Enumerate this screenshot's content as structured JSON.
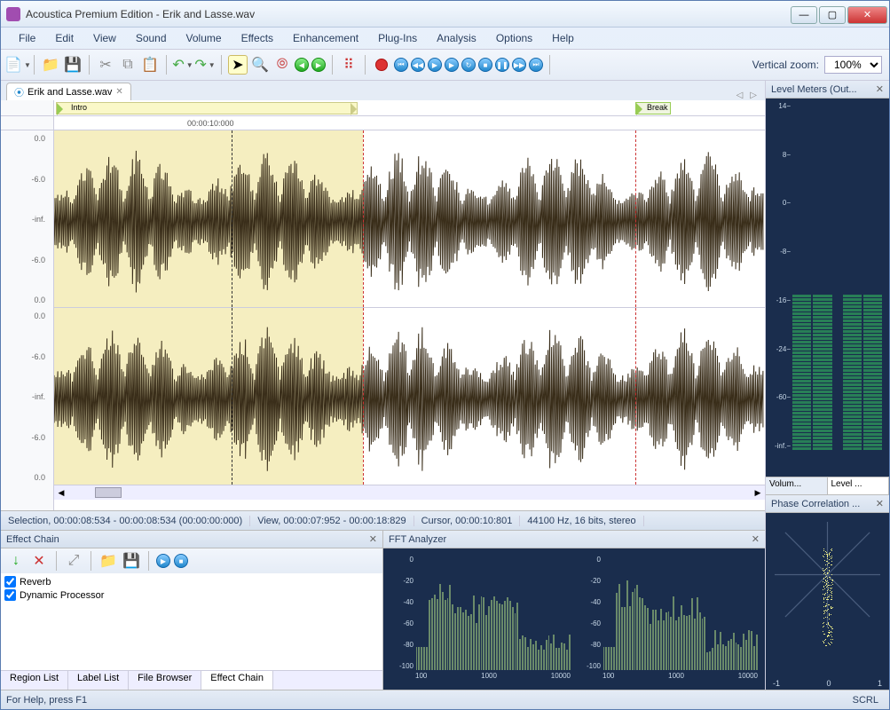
{
  "window": {
    "title": "Acoustica Premium Edition - Erik and Lasse.wav"
  },
  "menu": [
    "File",
    "Edit",
    "View",
    "Sound",
    "Volume",
    "Effects",
    "Enhancement",
    "Plug-Ins",
    "Analysis",
    "Options",
    "Help"
  ],
  "toolbar": {
    "vertical_zoom_label": "Vertical zoom:",
    "vertical_zoom_value": "100%"
  },
  "document": {
    "tab_label": "Erik and Lasse.wav",
    "timeline_cursor": "00:00:10:000",
    "markers": {
      "intro": "Intro",
      "break": "Break"
    },
    "db_scale": [
      "0.0",
      "-6.0",
      "-inf.",
      "-6.0",
      "0.0"
    ]
  },
  "status": {
    "selection": "Selection, 00:00:08:534 - 00:00:08:534 (00:00:00:000)",
    "view": "View, 00:00:07:952 - 00:00:18:829",
    "cursor": "Cursor, 00:00:10:801",
    "format": "44100 Hz, 16 bits, stereo"
  },
  "level_meters": {
    "title": "Level Meters (Out...",
    "scale": [
      "14−",
      "8−",
      "0−",
      "-8−",
      "-16−",
      "-24−",
      "-60−",
      "-inf.−"
    ],
    "tabs": [
      "Volum...",
      "Level ..."
    ]
  },
  "phase": {
    "title": "Phase Correlation ...",
    "labels": [
      "-1",
      "0",
      "1"
    ]
  },
  "effect_chain": {
    "title": "Effect Chain",
    "effects": [
      "Reverb",
      "Dynamic Processor"
    ],
    "tabs": [
      "Region List",
      "Label List",
      "File Browser",
      "Effect Chain"
    ]
  },
  "fft": {
    "title": "FFT Analyzer",
    "y_scale": [
      "0",
      "-20",
      "-40",
      "-60",
      "-80",
      "-100"
    ],
    "x_scale": [
      "100",
      "1000",
      "10000"
    ]
  },
  "footer": {
    "help": "For Help, press F1",
    "scrl": "SCRL"
  }
}
